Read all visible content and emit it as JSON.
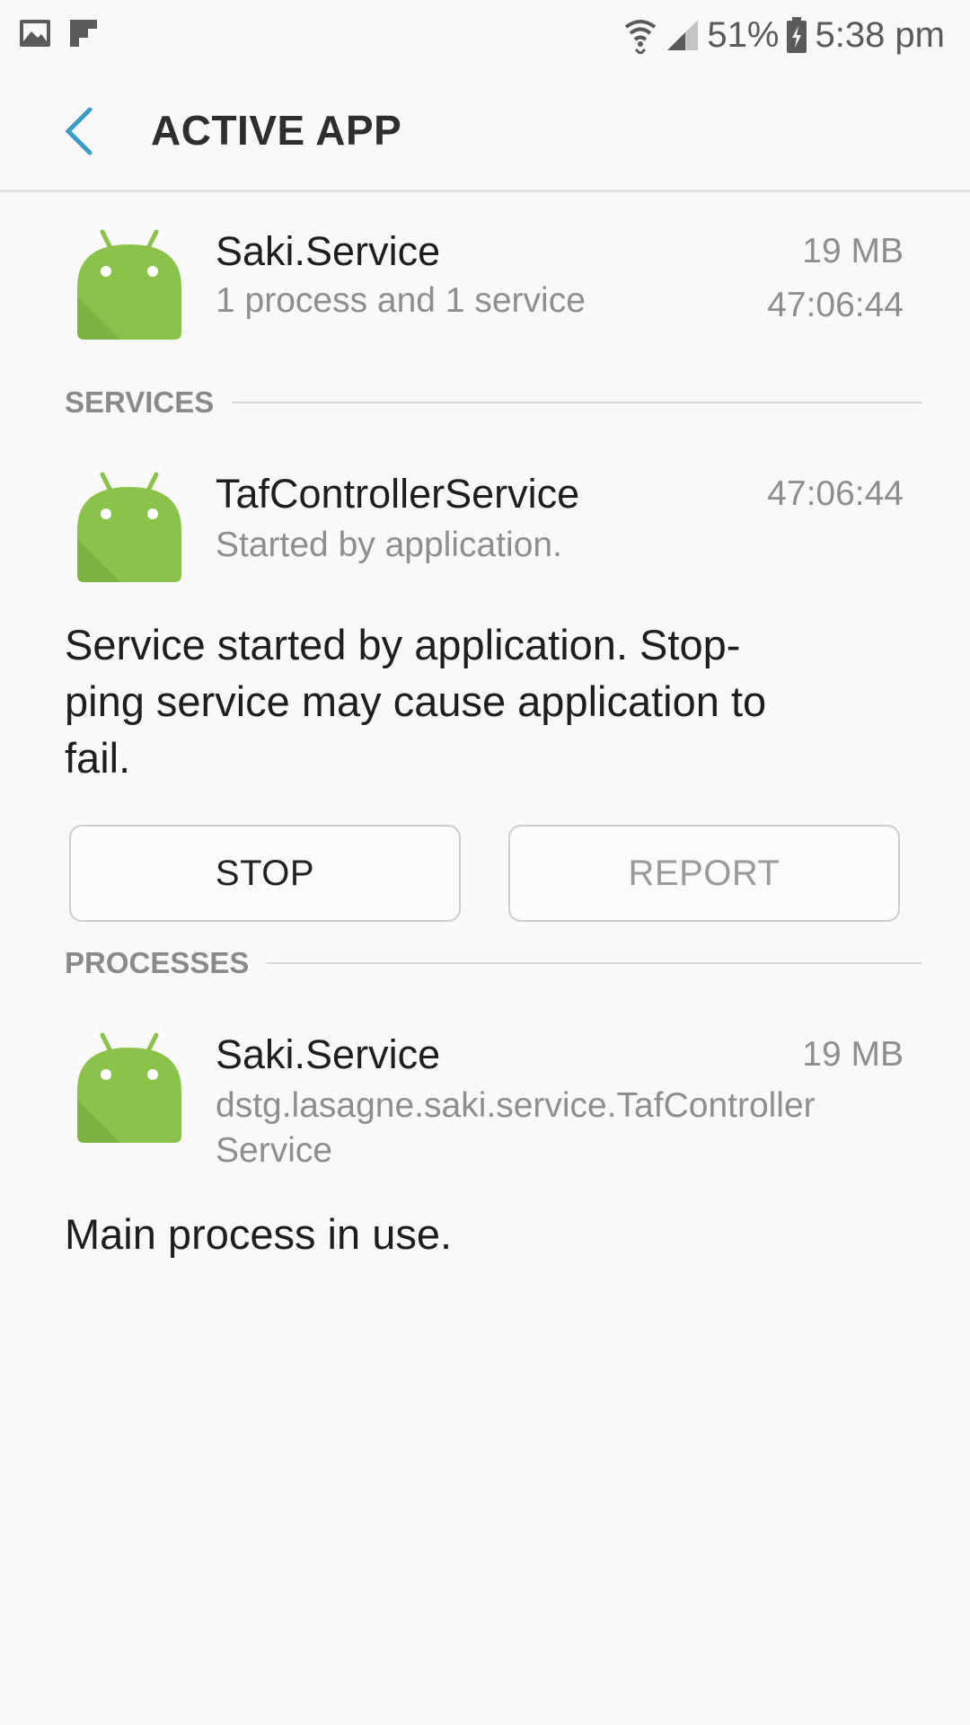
{
  "status_bar": {
    "battery": "51%",
    "time": "5:38 pm",
    "icons": [
      "gallery-icon",
      "flipboard-icon",
      "wifi-icon",
      "signal-icon",
      "battery-icon"
    ]
  },
  "header": {
    "title": "ACTIVE APP",
    "back_icon": "back-arrow-icon",
    "accent": "#3d9bc7"
  },
  "app": {
    "name": "Saki.Service",
    "summary": "1 process and 1 service",
    "size": "19 MB",
    "time": "47:06:44",
    "icon": "android-icon",
    "icon_color": "#8bc34a"
  },
  "services": {
    "section_label": "SERVICES",
    "items": [
      {
        "name": "TafControllerService",
        "sub": "Started by application.",
        "time": "47:06:44"
      }
    ],
    "description": "Service started by application. Stop-ping service may cause application to fail.",
    "desc_lines": [
      "Service started by application. Stop-",
      "ping service may cause application to",
      "fail."
    ],
    "stop_label": "STOP",
    "report_label": "REPORT"
  },
  "processes": {
    "section_label": "PROCESSES",
    "items": [
      {
        "name": "Saki.Service",
        "sub_lines": [
          "dstg.lasagne.saki.service.TafController",
          "Service"
        ],
        "size": "19 MB"
      }
    ],
    "description": "Main process in use."
  }
}
